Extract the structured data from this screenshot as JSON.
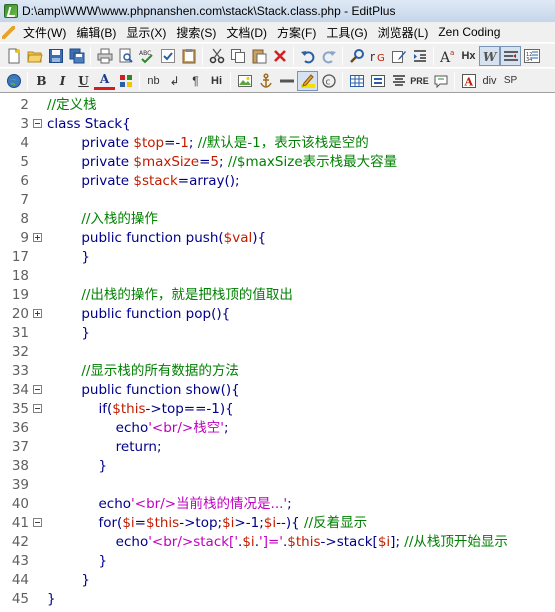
{
  "window": {
    "title": "D:\\amp\\WWW\\www.phpnanshen.com\\stack\\Stack.class.php - EditPlus"
  },
  "menu": [
    "文件(W)",
    "编辑(B)",
    "显示(X)",
    "搜索(S)",
    "文档(D)",
    "方案(F)",
    "工具(G)",
    "浏览器(L)",
    "Zen Coding"
  ],
  "toolbar2_labels": {
    "bold": "B",
    "italic": "I",
    "underline": "U",
    "font": "A",
    "nbsp": "nb",
    "br": "↲",
    "para": "¶",
    "heading": "Hi",
    "pre": "PRE",
    "div": "div",
    "span": "SP",
    "hx": "Hx"
  },
  "colors": {
    "keyword": "#00008b",
    "variable": "#c11c00",
    "comment": "#008000",
    "string": "#c000c0"
  },
  "icons": [
    "new-file-icon",
    "open-icon",
    "save-icon",
    "save-all-icon",
    "print-icon",
    "print-preview-icon",
    "spellcheck-icon",
    "cut-icon",
    "copy-icon",
    "paste-icon",
    "delete-icon",
    "undo-icon",
    "redo-icon",
    "find-icon",
    "replace-icon",
    "browser-icon"
  ],
  "code_lines": [
    {
      "num": "2",
      "fold": "",
      "tokens": [
        {
          "t": "cmt",
          "v": "//定义栈"
        }
      ]
    },
    {
      "num": "3",
      "fold": "minus",
      "tokens": [
        {
          "t": "kw",
          "v": "class Stack{"
        }
      ]
    },
    {
      "num": "4",
      "fold": "",
      "tokens": [
        {
          "t": "kw",
          "v": "        private "
        },
        {
          "t": "var",
          "v": "$top"
        },
        {
          "t": "op",
          "v": "=-"
        },
        {
          "t": "num",
          "v": "1"
        },
        {
          "t": "op",
          "v": "; "
        },
        {
          "t": "cmt",
          "v": "//默认是-1，表示该栈是空的"
        }
      ]
    },
    {
      "num": "5",
      "fold": "",
      "tokens": [
        {
          "t": "kw",
          "v": "        private "
        },
        {
          "t": "var",
          "v": "$maxSize"
        },
        {
          "t": "op",
          "v": "="
        },
        {
          "t": "num",
          "v": "5"
        },
        {
          "t": "op",
          "v": "; "
        },
        {
          "t": "cmt",
          "v": "//$maxSize表示栈最大容量"
        }
      ]
    },
    {
      "num": "6",
      "fold": "",
      "tokens": [
        {
          "t": "kw",
          "v": "        private "
        },
        {
          "t": "var",
          "v": "$stack"
        },
        {
          "t": "op",
          "v": "=array();"
        }
      ]
    },
    {
      "num": "7",
      "fold": "",
      "tokens": []
    },
    {
      "num": "8",
      "fold": "",
      "tokens": [
        {
          "t": "cmt",
          "v": "        //入栈的操作"
        }
      ]
    },
    {
      "num": "9",
      "fold": "plus",
      "tokens": [
        {
          "t": "kw",
          "v": "        public function push("
        },
        {
          "t": "var",
          "v": "$val"
        },
        {
          "t": "op",
          "v": "){"
        }
      ]
    },
    {
      "num": "17",
      "fold": "",
      "tokens": [
        {
          "t": "op",
          "v": "        }"
        }
      ]
    },
    {
      "num": "18",
      "fold": "",
      "tokens": []
    },
    {
      "num": "19",
      "fold": "",
      "tokens": [
        {
          "t": "cmt",
          "v": "        //出栈的操作，就是把栈顶的值取出"
        }
      ]
    },
    {
      "num": "20",
      "fold": "plus",
      "tokens": [
        {
          "t": "kw",
          "v": "        public function pop(){"
        }
      ]
    },
    {
      "num": "31",
      "fold": "",
      "tokens": [
        {
          "t": "op",
          "v": "        }"
        }
      ]
    },
    {
      "num": "32",
      "fold": "",
      "tokens": []
    },
    {
      "num": "33",
      "fold": "",
      "tokens": [
        {
          "t": "cmt",
          "v": "        //显示栈的所有数据的方法"
        }
      ]
    },
    {
      "num": "34",
      "fold": "minus",
      "tokens": [
        {
          "t": "kw",
          "v": "        public function show(){"
        }
      ]
    },
    {
      "num": "35",
      "fold": "minus",
      "tokens": [
        {
          "t": "kw",
          "v": "            if("
        },
        {
          "t": "var",
          "v": "$this"
        },
        {
          "t": "op",
          "v": "->top==-1){"
        }
      ]
    },
    {
      "num": "36",
      "fold": "",
      "tokens": [
        {
          "t": "kw",
          "v": "                echo"
        },
        {
          "t": "str",
          "v": "'<br/>栈空'"
        },
        {
          "t": "op",
          "v": ";"
        }
      ]
    },
    {
      "num": "37",
      "fold": "",
      "tokens": [
        {
          "t": "kw",
          "v": "                return;"
        }
      ]
    },
    {
      "num": "38",
      "fold": "",
      "tokens": [
        {
          "t": "op",
          "v": "            }"
        }
      ]
    },
    {
      "num": "39",
      "fold": "",
      "tokens": []
    },
    {
      "num": "40",
      "fold": "",
      "tokens": [
        {
          "t": "kw",
          "v": "            echo"
        },
        {
          "t": "str",
          "v": "'<br/>当前栈的情况是...'"
        },
        {
          "t": "op",
          "v": ";"
        }
      ]
    },
    {
      "num": "41",
      "fold": "minus",
      "tokens": [
        {
          "t": "kw",
          "v": "            for("
        },
        {
          "t": "var",
          "v": "$i"
        },
        {
          "t": "op",
          "v": "="
        },
        {
          "t": "var",
          "v": "$this"
        },
        {
          "t": "op",
          "v": "->top;"
        },
        {
          "t": "var",
          "v": "$i"
        },
        {
          "t": "op",
          "v": ">-1;"
        },
        {
          "t": "var",
          "v": "$i"
        },
        {
          "t": "op",
          "v": "--){ "
        },
        {
          "t": "cmt",
          "v": "//反着显示"
        }
      ]
    },
    {
      "num": "42",
      "fold": "",
      "tokens": [
        {
          "t": "kw",
          "v": "                echo"
        },
        {
          "t": "str",
          "v": "'<br/>stack['"
        },
        {
          "t": "op",
          "v": "."
        },
        {
          "t": "var",
          "v": "$i"
        },
        {
          "t": "op",
          "v": "."
        },
        {
          "t": "str",
          "v": "']='"
        },
        {
          "t": "op",
          "v": "."
        },
        {
          "t": "var",
          "v": "$this"
        },
        {
          "t": "op",
          "v": "->stack["
        },
        {
          "t": "var",
          "v": "$i"
        },
        {
          "t": "op",
          "v": "]; "
        },
        {
          "t": "cmt",
          "v": "//从栈顶开始显示"
        }
      ]
    },
    {
      "num": "43",
      "fold": "",
      "tokens": [
        {
          "t": "op",
          "v": "            }"
        }
      ]
    },
    {
      "num": "44",
      "fold": "",
      "tokens": [
        {
          "t": "op",
          "v": "        }"
        }
      ]
    },
    {
      "num": "45",
      "fold": "",
      "tokens": [
        {
          "t": "op",
          "v": "}"
        }
      ]
    }
  ]
}
